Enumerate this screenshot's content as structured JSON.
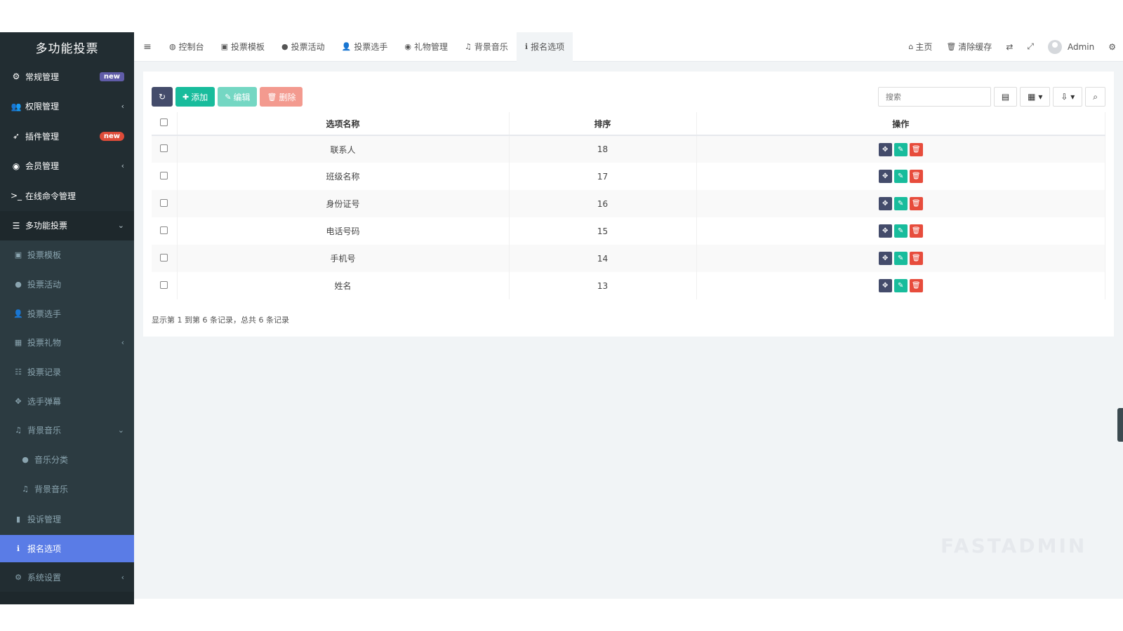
{
  "sidebar": {
    "logo": "多功能投票",
    "items": [
      {
        "label": "常规管理",
        "badge": "new"
      },
      {
        "label": "权限管理",
        "arrow": "‹"
      },
      {
        "label": "插件管理",
        "badge": "new"
      },
      {
        "label": "会员管理",
        "arrow": "‹"
      },
      {
        "label": "在线命令管理"
      },
      {
        "label": "多功能投票",
        "arrow": "⌄"
      }
    ],
    "sub": [
      {
        "label": "投票模板"
      },
      {
        "label": "投票活动"
      },
      {
        "label": "投票选手"
      },
      {
        "label": "投票礼物",
        "arrow": "‹"
      },
      {
        "label": "投票记录"
      },
      {
        "label": "选手弹幕"
      },
      {
        "label": "背景音乐",
        "arrow": "⌄"
      }
    ],
    "sub2": [
      {
        "label": "音乐分类"
      },
      {
        "label": "背景音乐"
      }
    ],
    "after": [
      {
        "label": "投诉管理"
      },
      {
        "label": "报名选项"
      },
      {
        "label": "系统设置",
        "arrow": "‹"
      }
    ]
  },
  "topbar": {
    "tabs": [
      "控制台",
      "投票模板",
      "投票活动",
      "投票选手",
      "礼物管理",
      "背景音乐",
      "报名选项"
    ],
    "home": "主页",
    "clear_cache": "清除缓存",
    "user": "Admin"
  },
  "toolbar": {
    "add": "添加",
    "edit": "编辑",
    "delete": "删除",
    "search_placeholder": "搜索"
  },
  "table": {
    "headers": [
      "选项名称",
      "排序",
      "操作"
    ],
    "rows": [
      {
        "name": "联系人",
        "sort": "18"
      },
      {
        "name": "班级名称",
        "sort": "17"
      },
      {
        "name": "身份证号",
        "sort": "16"
      },
      {
        "name": "电话号码",
        "sort": "15"
      },
      {
        "name": "手机号",
        "sort": "14"
      },
      {
        "name": "姓名",
        "sort": "13"
      }
    ]
  },
  "pager": "显示第 1 到第 6 条记录，总共 6 条记录",
  "watermark": "FASTADMIN",
  "colors": {
    "sidebar": "#222d32",
    "active": "#5a7ce6",
    "green": "#18bc9c",
    "red": "#e74c3c",
    "dark": "#444c6b"
  }
}
